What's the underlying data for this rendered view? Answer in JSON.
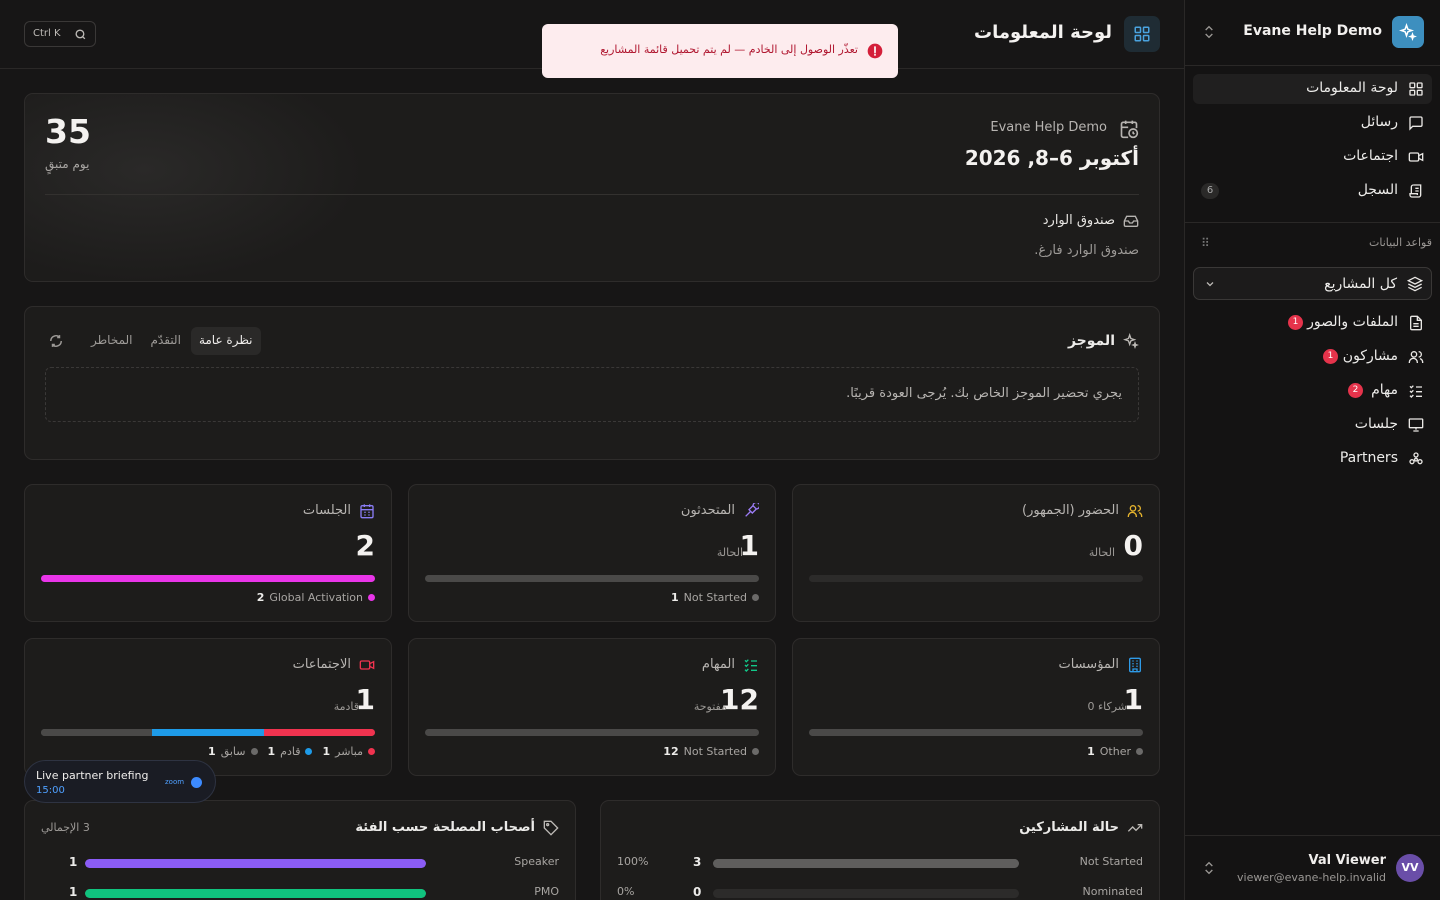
{
  "header": {
    "title": "لوحة المعلومات",
    "shortcut": "Ctrl K"
  },
  "toast": {
    "message": "تعذّر الوصول إلى الخادم — لم يتم تحميل قائمة المشاريع",
    "color": "#b0162f"
  },
  "sidebar": {
    "org_name": "Evane Help Demo",
    "nav": [
      {
        "label": "لوحة المعلومات",
        "icon": "dashboard-icon"
      },
      {
        "label": "رسائل",
        "icon": "message-icon"
      },
      {
        "label": "اجتماعات",
        "icon": "video-icon"
      },
      {
        "label": "السجل",
        "icon": "log-icon",
        "count": "6"
      }
    ],
    "section_label": "قواعد البيانات",
    "project_select": "كل المشاريع",
    "subnav": [
      {
        "label": "الملفات والصور",
        "badge": "1"
      },
      {
        "label": "مشاركون",
        "badge": "1"
      },
      {
        "label": "مهام",
        "badge": "2"
      },
      {
        "label": "جلسات"
      },
      {
        "label": "Partners"
      }
    ],
    "user": {
      "initials": "VV",
      "name": "Val Viewer",
      "email": "viewer@evane-help.invalid"
    }
  },
  "event": {
    "days_left": "35",
    "days_label": "يوم متبقٍ",
    "name": "Evane Help Demo",
    "date": "أكتوبر 6–8, 2026",
    "inbox_title": "صندوق الوارد",
    "inbox_empty": "صندوق الوارد فارغ."
  },
  "briefing": {
    "title": "الموجز",
    "tabs": [
      "نظرة عامة",
      "التقدّم",
      "المخاطر"
    ],
    "message": "يجري تحضير الموجز الخاص بك. يُرجى العودة قريبًا."
  },
  "stats": {
    "attendance": {
      "title": "الحضور (الجمهور)",
      "value": "0",
      "sub": "الحالة"
    },
    "speakers": {
      "title": "المتحدثون",
      "value": "1",
      "sub": "الحالة",
      "legend": [
        {
          "count": "1",
          "label": "Not Started",
          "color": "#6b6a69"
        }
      ]
    },
    "sessions": {
      "title": "الجلسات",
      "value": "2",
      "legend": [
        {
          "count": "2",
          "label": "Global Activation",
          "color": "#e935e9"
        }
      ]
    },
    "orgs": {
      "title": "المؤسسات",
      "value": "1",
      "sub": "0 شركاء",
      "legend": [
        {
          "count": "1",
          "label": "Other",
          "color": "#6b6a69"
        }
      ]
    },
    "tasks": {
      "title": "المهام",
      "value": "12",
      "sub": "مفتوحة",
      "legend": [
        {
          "count": "12",
          "label": "Not Started",
          "color": "#6b6a69"
        }
      ]
    },
    "meetings": {
      "title": "الاجتماعات",
      "value": "1",
      "sub": "قادمة",
      "legend": [
        {
          "count": "1",
          "label": "مباشر",
          "color": "#f0334f"
        },
        {
          "count": "1",
          "label": "قادم",
          "color": "#1e9be8"
        },
        {
          "count": "1",
          "label": "سابق",
          "color": "#6b6a69"
        }
      ]
    }
  },
  "stakeholders": {
    "title": "أصحاب المصلحة حسب الفئة",
    "total": "3 الإجمالي",
    "rows": [
      {
        "label": "Speaker",
        "value": "1",
        "fraction": 1.0,
        "color": "#8b5cf6"
      },
      {
        "label": "PMO",
        "value": "1",
        "fraction": 1.0,
        "color": "#10c37e"
      }
    ]
  },
  "participants": {
    "title": "حالة المشاركين",
    "rows": [
      {
        "label": "Not Started",
        "value": "3",
        "pct": "100%",
        "fraction": 1.0
      },
      {
        "label": "Nominated",
        "value": "0",
        "pct": "0%",
        "fraction": 0.0
      }
    ]
  },
  "live": {
    "title": "Live partner briefing",
    "time": "15:00",
    "source": "zoom"
  }
}
